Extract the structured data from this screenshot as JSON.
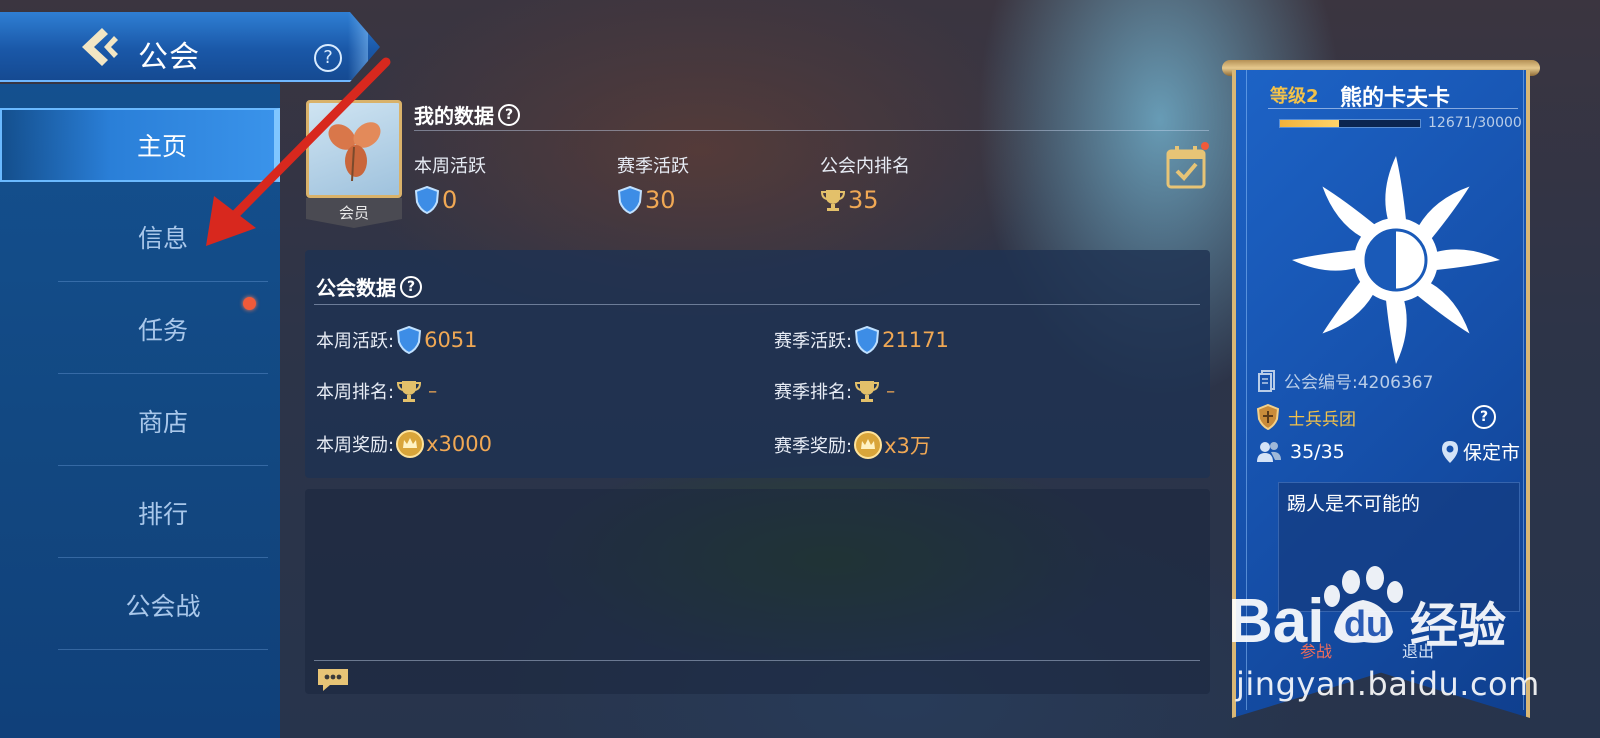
{
  "header": {
    "title": "公会",
    "help": "?"
  },
  "sidebar": {
    "items": [
      {
        "label": "主页",
        "active": true
      },
      {
        "label": "信息"
      },
      {
        "label": "任务",
        "badge": true
      },
      {
        "label": "商店"
      },
      {
        "label": "排行"
      },
      {
        "label": "公会战"
      }
    ]
  },
  "my_data": {
    "title": "我的数据",
    "role": "会员",
    "weekly_activity_label": "本周活跃",
    "weekly_activity_value": "0",
    "season_activity_label": "赛季活跃",
    "season_activity_value": "30",
    "rank_label": "公会内排名",
    "rank_value": "35"
  },
  "guild_data": {
    "title": "公会数据",
    "weekly_activity_label": "本周活跃:",
    "weekly_activity_value": "6051",
    "season_activity_label": "赛季活跃:",
    "season_activity_value": "21171",
    "weekly_rank_label": "本周排名:",
    "weekly_rank_value": "–",
    "season_rank_label": "赛季排名:",
    "season_rank_value": "–",
    "weekly_reward_label": "本周奖励:",
    "weekly_reward_value": "x3000",
    "season_reward_label": "赛季奖励:",
    "season_reward_value": "x3万"
  },
  "guild_banner": {
    "level": "等级2",
    "name": "熊的卡夫卡",
    "exp_text": "12671/30000",
    "exp_fraction": 0.42,
    "guild_id": "公会编号:4206367",
    "guild_type": "士兵兵团",
    "members": "35/35",
    "location": "保定市",
    "notice": "踢人是不可能的",
    "action_left": "参战",
    "action_right": "退出"
  },
  "watermark": {
    "brand": "Baidu 经验",
    "url": "jingyan.baidu.com"
  },
  "colors": {
    "accent_orange": "#f0a854",
    "sidebar_blue": "#14508f",
    "gold": "#d9b775",
    "badge_red": "#f05a3a"
  }
}
